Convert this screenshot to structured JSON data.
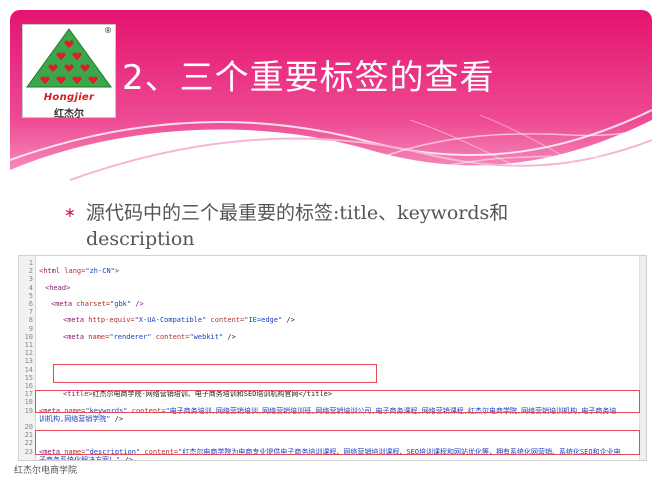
{
  "slide": {
    "title": "2、三个重要标签的查看",
    "bullet": "源代码中的三个最重要的标签:title、keywords和description",
    "bullet_marker": "∗",
    "footer": "红杰尔电商学院"
  },
  "logo": {
    "english": "Hongjier",
    "chinese": "红杰尔",
    "reg_mark": "®",
    "icon": "tree-hearts-logo"
  },
  "colors": {
    "header_pink": "#e8197a",
    "header_light": "#f48cb9",
    "accent": "#d4145a",
    "highlight_box": "#e44b5a"
  },
  "code_lines": [
    {
      "n": "1",
      "tag1": "",
      "attr1": "",
      "val1": "",
      "tag2": "",
      "attr2": "",
      "val2": "",
      "tail": ""
    },
    {
      "n": "2",
      "tag1": "<html",
      "attr1": " lang=",
      "val1": "\"zh-CN\"",
      "tag2": ">",
      "attr2": "",
      "val2": "",
      "tail": ""
    },
    {
      "n": "3",
      "tag1": "",
      "attr1": "",
      "val1": "",
      "tag2": "",
      "attr2": "",
      "val2": "",
      "tail": ""
    },
    {
      "n": "4",
      "tag1": "<head>",
      "attr1": "",
      "val1": "",
      "tag2": "",
      "attr2": "",
      "val2": "",
      "tail": ""
    },
    {
      "n": "5",
      "tag1": "",
      "attr1": "",
      "val1": "",
      "tag2": "",
      "attr2": "",
      "val2": "",
      "tail": ""
    },
    {
      "n": "6",
      "tag1": "<meta",
      "attr1": " charset=",
      "val1": "\"gbk\"",
      "tag2": " />",
      "attr2": "",
      "val2": "",
      "tail": ""
    },
    {
      "n": "7",
      "tag1": "",
      "attr1": "",
      "val1": "",
      "tag2": "",
      "attr2": "",
      "val2": "",
      "tail": ""
    },
    {
      "n": "8",
      "tag1": "<meta",
      "attr1": " http-equiv=",
      "val1": "\"X-UA-Compatible\"",
      "tag2": "",
      "attr2": " content=",
      "val2": "\"IE=edge\"",
      "tail": " />"
    },
    {
      "n": "9",
      "tag1": "",
      "attr1": "",
      "val1": "",
      "tag2": "",
      "attr2": "",
      "val2": "",
      "tail": ""
    },
    {
      "n": "10",
      "tag1": "<meta",
      "attr1": " name=",
      "val1": "\"renderer\"",
      "tag2": "",
      "attr2": " content=",
      "val2": "\"webkit\"",
      "tail": " />"
    },
    {
      "n": "11",
      "tag1": "",
      "attr1": "",
      "val1": "",
      "tag2": "",
      "attr2": "",
      "val2": "",
      "tail": ""
    },
    {
      "n": "12",
      "tag1": "",
      "attr1": "",
      "val1": "",
      "tag2": "",
      "attr2": "",
      "val2": "",
      "tail": ""
    },
    {
      "n": "13",
      "tag1": "",
      "attr1": "",
      "val1": "",
      "tag2": "",
      "attr2": "",
      "val2": "",
      "tail": ""
    },
    {
      "n": "14",
      "tag1": "",
      "attr1": "",
      "val1": "",
      "tag2": "",
      "attr2": "",
      "val2": "",
      "tail": ""
    },
    {
      "n": "15",
      "tag1": "",
      "attr1": "",
      "val1": "",
      "tag2": "",
      "attr2": "",
      "val2": "",
      "tail": ""
    },
    {
      "n": "16",
      "tag1": "",
      "attr1": "",
      "val1": "",
      "tag2": "",
      "attr2": "",
      "val2": "",
      "tail": ""
    },
    {
      "n": "17",
      "tag1": "<title>",
      "attr1": "",
      "val1": "",
      "tag2": "",
      "attr2": "",
      "val2": "",
      "tail": "红杰尔电商学院-网络营销培训、电子商务培训和SEO培训机构官网</title>"
    },
    {
      "n": "18",
      "tag1": "",
      "attr1": "",
      "val1": "",
      "tag2": "",
      "attr2": "",
      "val2": "",
      "tail": ""
    },
    {
      "n": "19",
      "tag1": "<meta",
      "attr1": " name=",
      "val1": "\"keywords\"",
      "tag2": "",
      "attr2": " content=",
      "val2": "\"电子商务培训,网络营销培训,网络营销培训班,网络营销培训公司,电子商务课程,网络营销课程,红杰尔电商学院,网络营销培训机构,电子商务培",
      "tail": ""
    },
    {
      "n": "",
      "tag1": "",
      "attr1": "",
      "val1": "",
      "tag2": "",
      "attr2": "",
      "val2": "训机构,网络营销学院\"",
      "tail": " />"
    },
    {
      "n": "20",
      "tag1": "",
      "attr1": "",
      "val1": "",
      "tag2": "",
      "attr2": "",
      "val2": "",
      "tail": ""
    },
    {
      "n": "21",
      "tag1": "",
      "attr1": "",
      "val1": "",
      "tag2": "",
      "attr2": "",
      "val2": "",
      "tail": ""
    },
    {
      "n": "22",
      "tag1": "",
      "attr1": "",
      "val1": "",
      "tag2": "",
      "attr2": "",
      "val2": "",
      "tail": ""
    },
    {
      "n": "23",
      "tag1": "<meta",
      "attr1": " name=",
      "val1": "\"description\"",
      "tag2": "",
      "attr2": " content=",
      "val2": "\"红杰尔电商学院为电商专业提供电子商务培训课程、网络营销培训课程、SEO培训课程和网站优化等，拥有系统化网营销、系统化SEO和企业电",
      "tail": ""
    },
    {
      "n": "",
      "tag1": "",
      "attr1": "",
      "val1": "",
      "tag2": "",
      "attr2": "",
      "val2": "子商务系统化解决方案！\"",
      "tail": " />"
    },
    {
      "n": "24",
      "tag1": "",
      "attr1": "",
      "val1": "",
      "tag2": "",
      "attr2": "",
      "val2": "",
      "tail": ""
    }
  ]
}
